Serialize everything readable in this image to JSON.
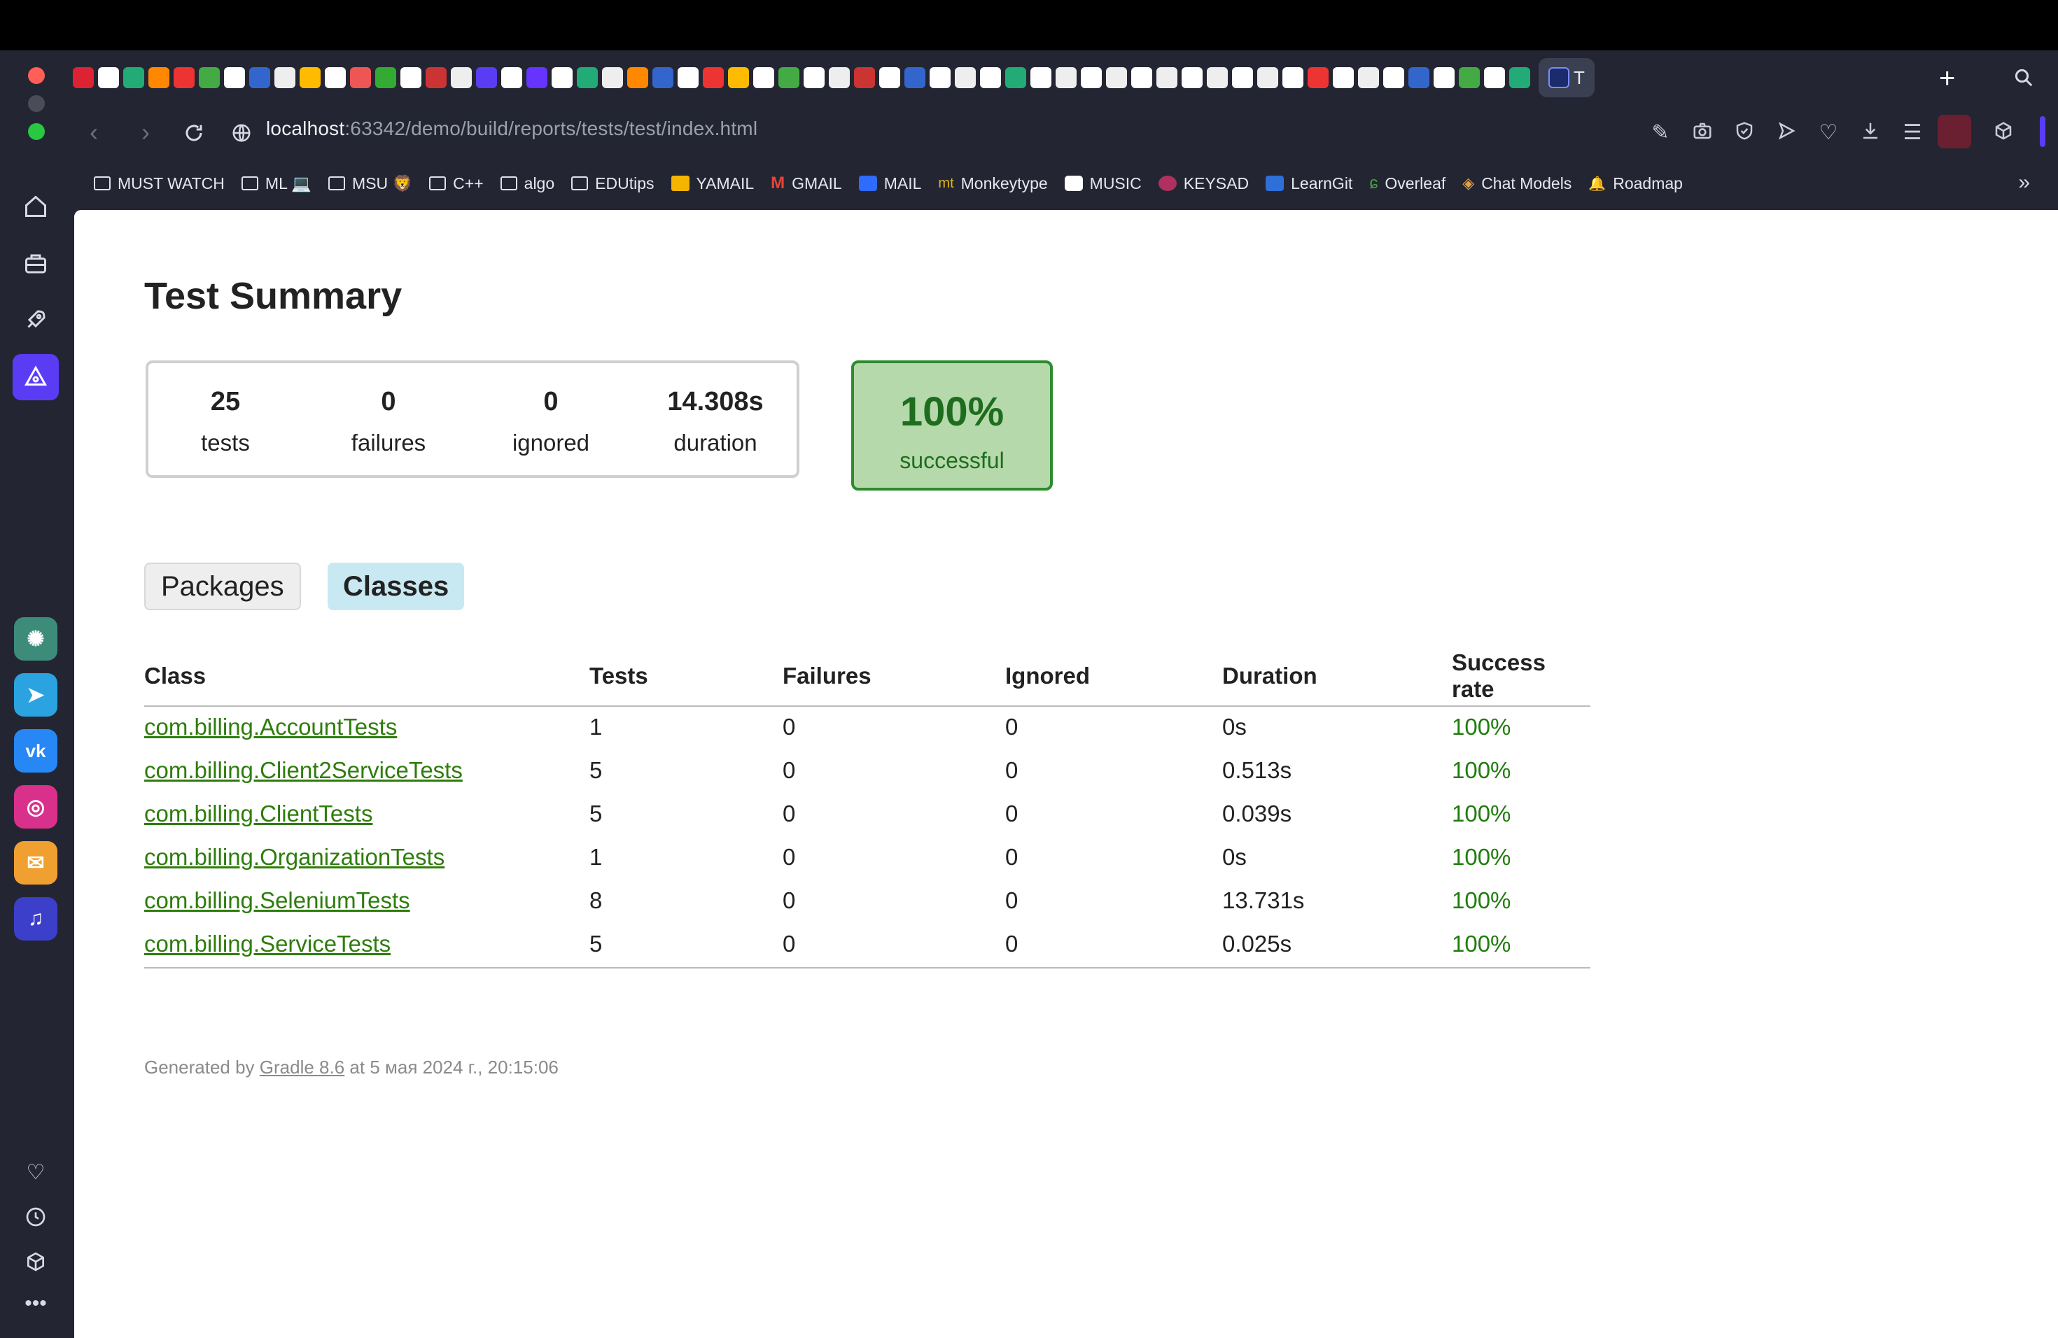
{
  "browser": {
    "url_host": "localhost",
    "url_rest": ":63342/demo/build/reports/tests/test/index.html",
    "active_tab_label": "T",
    "bookmarks": [
      {
        "label": "MUST WATCH",
        "icon": "folder-icon"
      },
      {
        "label": "ML 💻",
        "icon": "folder-icon"
      },
      {
        "label": "MSU 🦁",
        "icon": "folder-icon"
      },
      {
        "label": "C++",
        "icon": "folder-icon"
      },
      {
        "label": "algo",
        "icon": "folder-icon"
      },
      {
        "label": "EDUtips",
        "icon": "folder-icon"
      },
      {
        "label": "YAMAIL",
        "icon": "mail-icon"
      },
      {
        "label": "GMAIL",
        "icon": "gmail-icon"
      },
      {
        "label": "MAIL",
        "icon": "mail-box-icon"
      },
      {
        "label": "Monkeytype",
        "icon": "monkeytype-icon"
      },
      {
        "label": "MUSIC",
        "icon": "music-icon"
      },
      {
        "label": "KEYSAD",
        "icon": "keysad-icon"
      },
      {
        "label": "LearnGit",
        "icon": "learngit-icon"
      },
      {
        "label": "Overleaf",
        "icon": "overleaf-icon"
      },
      {
        "label": "Chat Models",
        "icon": "chat-models-icon"
      },
      {
        "label": "Roadmap",
        "icon": "roadmap-icon"
      }
    ],
    "colors": {
      "frame": "#232632",
      "accent": "#5b3cf5",
      "success_green": "#1f7d0d"
    }
  },
  "report": {
    "title": "Test Summary",
    "counters": [
      {
        "value": "25",
        "label": "tests"
      },
      {
        "value": "0",
        "label": "failures"
      },
      {
        "value": "0",
        "label": "ignored"
      },
      {
        "value": "14.308s",
        "label": "duration"
      }
    ],
    "success": {
      "value": "100%",
      "label": "successful"
    },
    "tabs": [
      {
        "label": "Packages",
        "selected": false
      },
      {
        "label": "Classes",
        "selected": true
      }
    ],
    "columns": [
      "Class",
      "Tests",
      "Failures",
      "Ignored",
      "Duration",
      "Success rate"
    ],
    "rows": [
      {
        "class": "com.billing.AccountTests",
        "tests": "1",
        "failures": "0",
        "ignored": "0",
        "duration": "0s",
        "rate": "100%"
      },
      {
        "class": "com.billing.Client2ServiceTests",
        "tests": "5",
        "failures": "0",
        "ignored": "0",
        "duration": "0.513s",
        "rate": "100%"
      },
      {
        "class": "com.billing.ClientTests",
        "tests": "5",
        "failures": "0",
        "ignored": "0",
        "duration": "0.039s",
        "rate": "100%"
      },
      {
        "class": "com.billing.OrganizationTests",
        "tests": "1",
        "failures": "0",
        "ignored": "0",
        "duration": "0s",
        "rate": "100%"
      },
      {
        "class": "com.billing.SeleniumTests",
        "tests": "8",
        "failures": "0",
        "ignored": "0",
        "duration": "13.731s",
        "rate": "100%"
      },
      {
        "class": "com.billing.ServiceTests",
        "tests": "5",
        "failures": "0",
        "ignored": "0",
        "duration": "0.025s",
        "rate": "100%"
      }
    ],
    "footer": {
      "prefix": "Generated by ",
      "link": "Gradle 8.6",
      "suffix": " at 5 мая 2024 г., 20:15:06"
    }
  }
}
